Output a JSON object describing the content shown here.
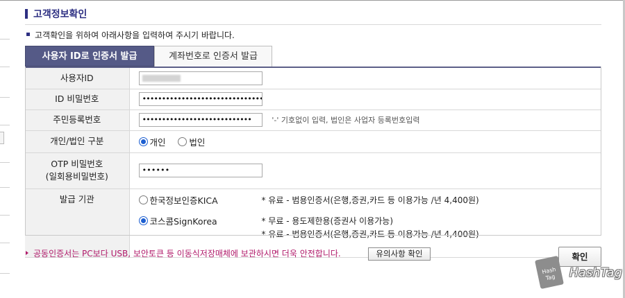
{
  "page": {
    "title": "고객정보확인",
    "intro": "고객확인을 위하여 아래사항을 입력하여 주시기 바랍니다."
  },
  "tabs": [
    {
      "label": "사용자 ID로 인증서 발급",
      "active": true
    },
    {
      "label": "계좌번호로 인증서 발급",
      "active": false
    }
  ],
  "form": {
    "user_id": {
      "label": "사용자ID",
      "value": ""
    },
    "id_password": {
      "label": "ID 비밀번호",
      "value": "••••••••••••••••••••••••••••••••••"
    },
    "resident_number": {
      "label": "주민등록번호",
      "value": "••••••••••••••••••••••••••••",
      "hint": "'-' 기호없이 입력, 법인은 사업자 등록번호입력"
    },
    "entity_type": {
      "label": "개인/법인 구분",
      "options": [
        {
          "label": "개인",
          "selected": true
        },
        {
          "label": "법인",
          "selected": false
        }
      ]
    },
    "otp": {
      "label_line1": "OTP 비밀번호",
      "label_line2": "(일회용비밀번호)",
      "value": "••••••"
    },
    "issuer": {
      "label": "발급 기관",
      "options": [
        {
          "label": "한국정보인증KICA",
          "selected": false,
          "desc": [
            "* 유료 - 범용인증서(은행,증권,카드 등 이용가능 /년 4,400원)"
          ]
        },
        {
          "label": "코스콤SignKorea",
          "selected": true,
          "desc": [
            "* 무료 - 용도제한용(증권사 이용가능)",
            "* 유료 - 범용인증서(은행,증권,카드 등 이용가능 /년 4,400원)"
          ]
        }
      ]
    }
  },
  "notice": {
    "text": "공동인증서는 PC보다 USB, 보안토큰 등 이동식저장매체에 보관하시면 더욱 안전합니다.",
    "caution_button": "유의사항 확인"
  },
  "confirm_button": "확인",
  "watermark": {
    "badge": "Hash Tag",
    "text": "HashTag"
  },
  "colors": {
    "accent": "#2d2f82",
    "tab_active": "#555a87",
    "notice": "#b01a6a",
    "radio": "#1d5fd1"
  }
}
